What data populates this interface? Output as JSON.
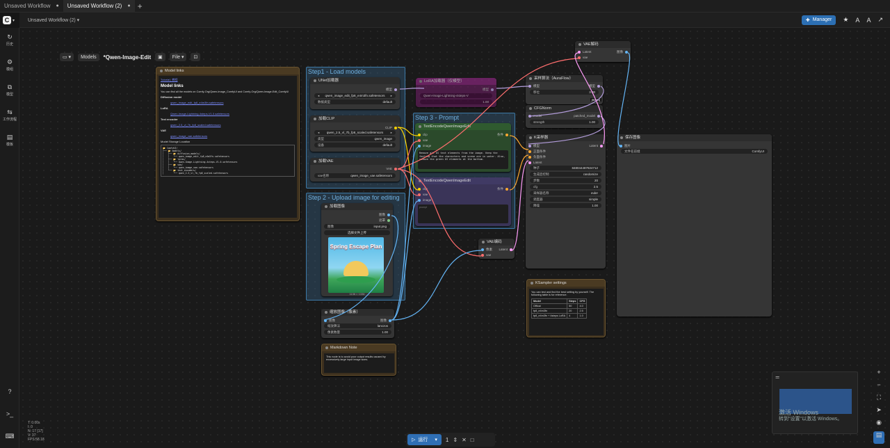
{
  "tabs": [
    {
      "label": "Unsaved Workflow",
      "dot": "●"
    },
    {
      "label": "Unsaved Workflow (2)",
      "dot": "●"
    }
  ],
  "toolbar": {
    "workflow_title": "Unsaved Workflow (2) ▾",
    "manager": "Manager"
  },
  "sidebar": [
    {
      "icon": "↻",
      "label": "历史"
    },
    {
      "icon": "⚙",
      "label": "模组"
    },
    {
      "icon": "⧉",
      "label": "模型"
    },
    {
      "icon": "⇆",
      "label": "工作流程"
    },
    {
      "icon": "▤",
      "label": "模板"
    },
    {
      "icon": "?",
      "label": ""
    },
    {
      "icon": ">_",
      "label": ""
    },
    {
      "icon": "⌨",
      "label": ""
    }
  ],
  "workflow_bar": {
    "models": "Models",
    "name": "*Qwen-Image-Edit",
    "file": "File ▾"
  },
  "groups": {
    "g1": "Step1 - Load models",
    "g2": "Step 2 - Upload image for editing",
    "g3": "Step 3 - Prompt"
  },
  "nodes": {
    "model_links": {
      "title": "Model links",
      "tutorial": "Tutorial | 教程",
      "heading": "Model links",
      "intro": "You can find all the models on Comfy-Org/Qwen-Image_ComfyUI and Comfy-Org/Qwen-Image-Edit_ComfyUI",
      "diffusion": "Diffusion model",
      "diff_file": "qwen_image_edit_fp8_e4m3fn.safetensors",
      "lora": "LoRA",
      "lora_file": "Qwen-Image-Lightning-4steps-V1.0.safetensors",
      "te": "Text encoder",
      "te_file": "qwen_2.5_vl_7b_fp8_scaled.safetensors",
      "vae": "VAE",
      "vae_file": "qwen_image_vae.safetensors",
      "storage": "Model Storage Location",
      "tree": "📂 ComfyUI/\n├── 📂 models/\n│   ├── 📂 diffusion_models/\n│   │   └── qwen_image_edit_fp8_e4m3fn.safetensors\n│   ├── 📂 loras/\n│   │   └── Qwen-Image-Lightning-4steps-V1.0.safetensors\n│   ├── 📂 vae/\n│   │   └── qwen_image_vae.safetensors\n│   └── 📂 text_encoders/\n│       └── qwen_2.5_vl_7b_fp8_scaled.safetensors"
    },
    "unet": {
      "title": "UNet加载器",
      "out": "模型",
      "w1": "qwen_image_edit_fp8_e4m3fn.safetensors",
      "w2l": "数据类型",
      "w2v": "default"
    },
    "clip": {
      "title": "加载CLIP",
      "out": "CLIP",
      "w1": "qwen_2.5_vl_7b_fp8_scaled.safetensors",
      "w2l": "类型",
      "w2v": "qwen_image",
      "w3l": "设备",
      "w3v": "default"
    },
    "vae": {
      "title": "加载VAE",
      "out": "VAE",
      "w1l": "vae名称",
      "w1v": "qwen_image_vae.safetensors"
    },
    "lora": {
      "title": "LoRA加载器（仅模型）",
      "out": "模型",
      "w1": "Qwen-Image-Lightning-4steps-V",
      "w2": "1.00"
    },
    "load_image": {
      "title": "加载图像",
      "out1": "图像",
      "out2": "遮罩",
      "w1l": "图像",
      "w1v": "input.png",
      "upload": "选择文件上传",
      "dims": "1136 × 1336",
      "img_title": "Spring Escape Plan"
    },
    "scale": {
      "title": "缩放图像（像素）",
      "in": "图像",
      "out": "图像",
      "w1l": "缩放算法",
      "w1v": "lanczos",
      "w2l": "像素数量",
      "w2v": "1.00"
    },
    "note": {
      "title": "Markdown Note",
      "text": "This node is to avoid poor output results caused by excessively large input image sizes."
    },
    "te_pos": {
      "title": "TextEncodeQwenImageEdit",
      "in1": "clip",
      "in2": "vae",
      "in3": "image",
      "out": "条件",
      "text": "Remove all UI text elements from the image. Keep the feeling that the characters and scene are in water. Also, remove the green UI elements at the bottom."
    },
    "te_neg": {
      "title": "TextEncodeQwenImageEdit",
      "in1": "clip",
      "in2": "vae",
      "in3": "image",
      "out": "条件",
      "placeholder": "prompt"
    },
    "aura": {
      "title": "采样算法（AuraFlow）",
      "in": "模型",
      "out": "模型",
      "w1l": "移位",
      "w1v": "3.00",
      "badge": "[BETA]"
    },
    "cfgnorm": {
      "title": "CFGNorm",
      "in": "model",
      "out": "patched_model",
      "w1l": "strength",
      "w1v": "1.00"
    },
    "ksampler": {
      "title": "K采样器",
      "in1": "模型",
      "in2": "正面条件",
      "in3": "负面条件",
      "in4": "Latent",
      "out": "Latent",
      "seed_l": "种子",
      "seed_v": "848044487824712",
      "ctrl_l": "生成后控制",
      "ctrl_v": "randomize",
      "steps_l": "步数",
      "steps_v": "20",
      "cfg_l": "cfg",
      "cfg_v": "2.5",
      "sampler_l": "采样器名称",
      "sampler_v": "euler",
      "sched_l": "调度器",
      "sched_v": "simple",
      "denoise_l": "降噪",
      "denoise_v": "1.00"
    },
    "vae_encode": {
      "title": "VAE编码",
      "in1": "像素",
      "in2": "vae",
      "out": "Latent"
    },
    "vae_decode": {
      "title": "VAE解码",
      "in1": "Latent",
      "in2": "vae",
      "out": "图像"
    },
    "save": {
      "title": "保存图像",
      "in": "图片",
      "w1l": "文件名前缀",
      "w1v": "ComfyUI"
    },
    "ks_settings": {
      "title": "KSampler settings",
      "text": "You can test and find the best setting by yourself. The following table is for reference.",
      "cols": [
        "Model",
        "Steps",
        "CFG"
      ],
      "rows": [
        [
          "Offical",
          "50",
          "4.0"
        ],
        [
          "fp8_e4m3fn",
          "20",
          "2.5"
        ],
        [
          "fp8_e4m3fn + 4steps LoRA",
          "4",
          "1.0"
        ]
      ]
    }
  },
  "runbar": {
    "run": "运行",
    "count": "1"
  },
  "stats": [
    "T: 0.00s",
    "I: 0",
    "N: 17 [17]",
    "V: 37",
    "FPS:58.18"
  ],
  "watermark": {
    "line1": "激活 Windows",
    "line2": "转到\"设置\"以激活 Windows。"
  },
  "colors": {
    "accent": "#2f6fb5",
    "clip": "#ffd500",
    "vae": "#ff6e6e",
    "model": "#b39ddb",
    "latent": "#ff9cf9",
    "image": "#64b5f6",
    "cond": "#ffa931"
  }
}
